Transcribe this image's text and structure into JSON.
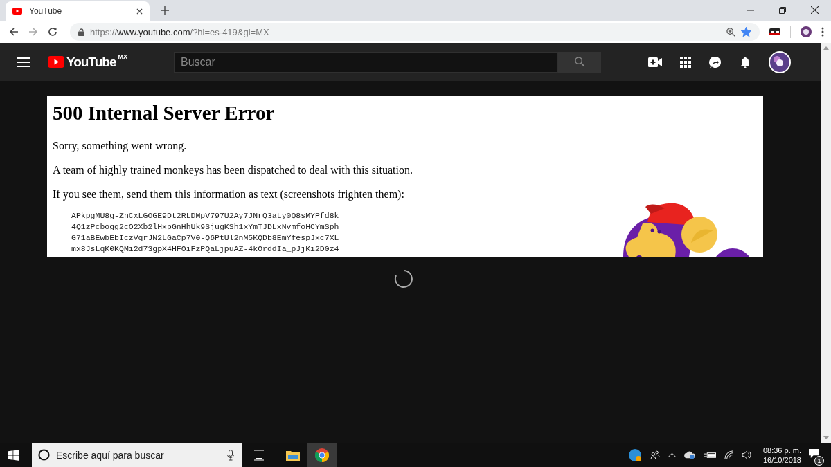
{
  "browser": {
    "tab_title": "YouTube",
    "url": {
      "scheme": "https://",
      "host": "www.youtube.com",
      "path": "/?hl=es-419&gl=MX"
    },
    "bookmarked": true
  },
  "youtube": {
    "logo_text": "YouTube",
    "region": "MX",
    "search": {
      "placeholder": "Buscar"
    }
  },
  "error": {
    "title": "500 Internal Server Error",
    "paragraphs": [
      "Sorry, something went wrong.",
      "A team of highly trained monkeys has been dispatched to deal with this situation.",
      "If you see them, send them this information as text (screenshots frighten them):"
    ],
    "code_lines": [
      "APkpgMU8g-ZnCxLGOGE9Dt2RLDMpV797U2Ay7JNrQ3aLy0Q8sMYPfd8k",
      "4Q1zPcbogg2cO2Xb2lHxpGnHhUk9SjugKSh1xYmTJDLxNvmfoHCYmSph",
      "G71aBEwbEbIczVqrJN2LGaCp7V0-Q6PtUl2nM5KQDb8EmYfespJxc7XL",
      "mx8JsLqK0KQMi2d73gpX4HFOiFzPQaLjpuAZ-4kOrddIa_pJjKi2D0z4"
    ]
  },
  "taskbar": {
    "search": {
      "placeholder": "Escribe aquí para buscar"
    },
    "clock": {
      "time": "08:36 p. m.",
      "date": "16/10/2018"
    },
    "notification_count": "1"
  }
}
